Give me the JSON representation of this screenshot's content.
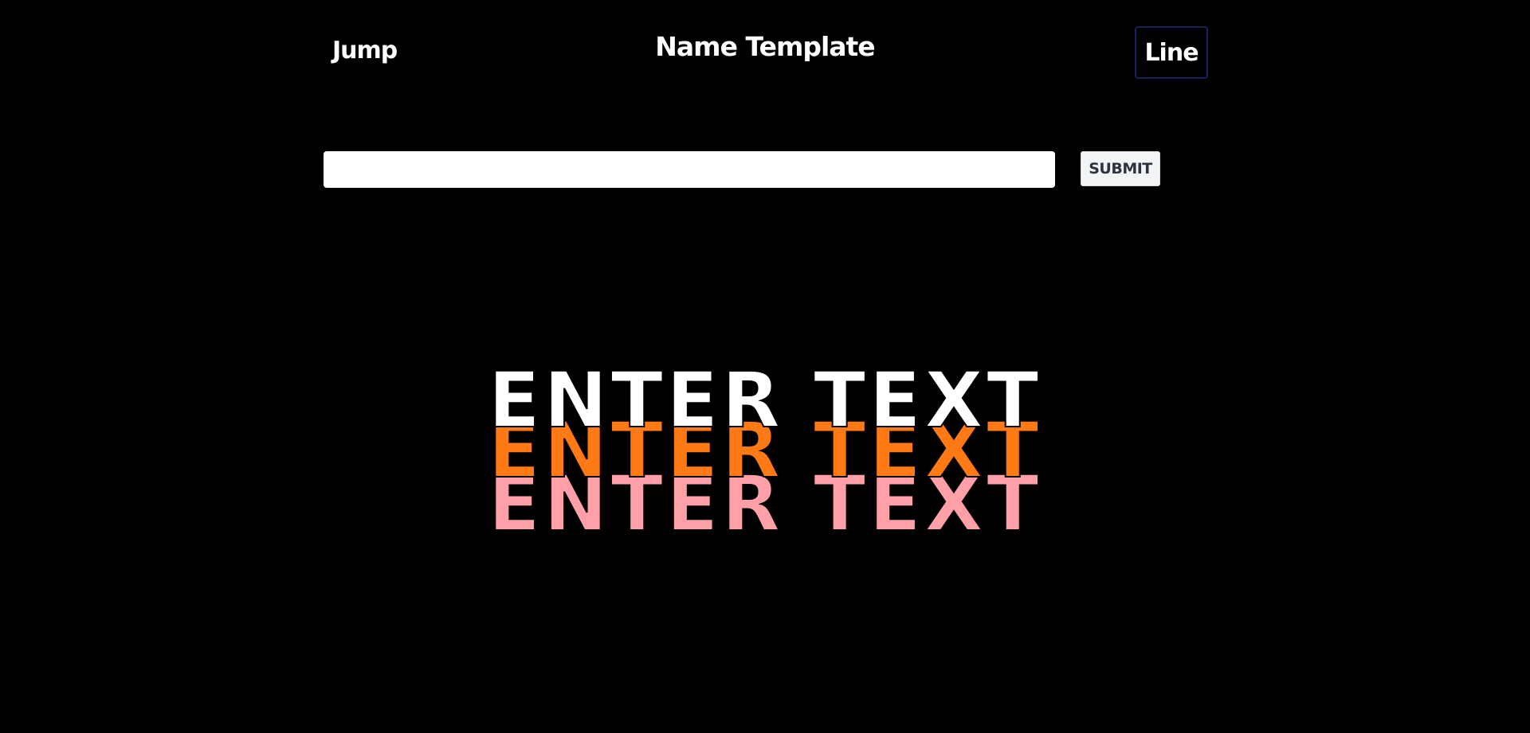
{
  "header": {
    "nav_left_label": "Jump",
    "title": "Name Template",
    "nav_right_label": "Line"
  },
  "form": {
    "input_value": "",
    "input_placeholder": "",
    "submit_label": "SUBMIT"
  },
  "preview": {
    "lines": [
      {
        "text": "ENTER TEXT",
        "color": "#ffffff"
      },
      {
        "text": "ENTER TEXT",
        "color": "#ff7a14"
      },
      {
        "text": "ENTER TEXT",
        "color": "#ff9fa8"
      }
    ]
  },
  "colors": {
    "background": "#000000",
    "nav_right_border": "#1a1f5c",
    "submit_background": "#f3f4f6",
    "submit_text": "#2d3340"
  }
}
